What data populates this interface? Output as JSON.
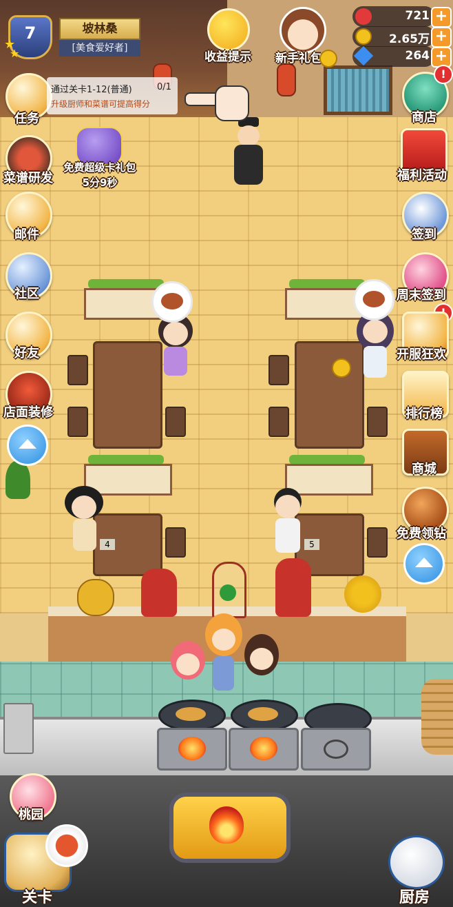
{
  "player": {
    "level": "7",
    "name": "坡林桑",
    "title": "[美食爱好者]"
  },
  "currencies": {
    "hearts": "721",
    "coins": "2.65万",
    "gems": "264"
  },
  "top_center": {
    "earnings_tip": "收益提示",
    "newbie_gift": "新手礼包"
  },
  "quest": {
    "label": "任务",
    "goal": "通过关卡1-12(普通)",
    "progress": "0/1",
    "hint": "升级厨师和菜谱可提高得分"
  },
  "gift_pack": {
    "title": "免费超级卡礼包",
    "timer": "5分9秒"
  },
  "left_menu": [
    "菜谱研发",
    "邮件",
    "社区",
    "好友",
    "店面装修"
  ],
  "right_menu": [
    "商店",
    "福利活动",
    "签到",
    "周末签到",
    "开服狂欢",
    "排行榜",
    "商城",
    "免费领钻"
  ],
  "table_numbers": [
    "4",
    "5"
  ],
  "bottom": {
    "peach_garden": "桃园",
    "levels": "关卡",
    "kitchen": "厨房"
  },
  "colors": {
    "accent": "#f39a2b",
    "badge": "#e22f2f",
    "label_outline": "#3b1e0e"
  }
}
